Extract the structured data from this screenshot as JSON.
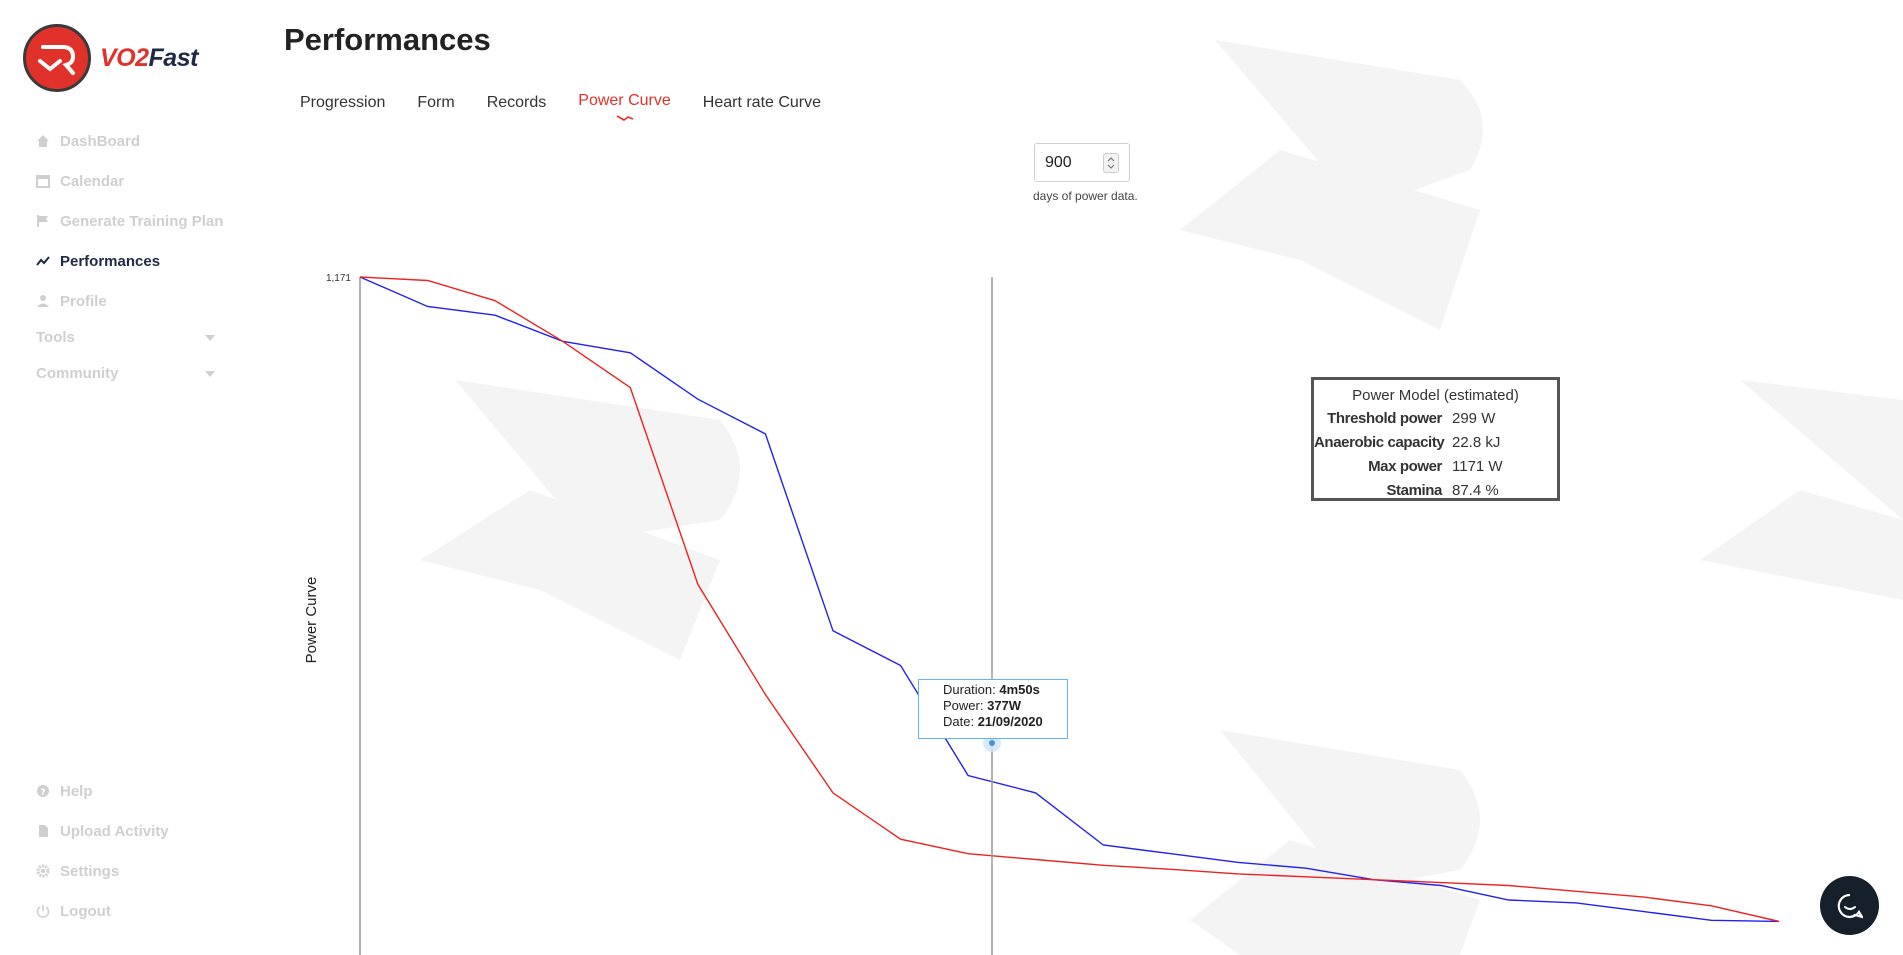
{
  "app": {
    "name_part1": "VO2",
    "name_part2": "Fast"
  },
  "sidebar": {
    "items": [
      {
        "label": "DashBoard",
        "icon": "home-icon"
      },
      {
        "label": "Calendar",
        "icon": "calendar-icon"
      },
      {
        "label": "Generate Training Plan",
        "icon": "flag-icon"
      },
      {
        "label": "Performances",
        "icon": "trend-icon",
        "active": true
      },
      {
        "label": "Profile",
        "icon": "user-icon"
      }
    ],
    "sections": [
      {
        "label": "Tools"
      },
      {
        "label": "Community"
      }
    ],
    "bottom_items": [
      {
        "label": "Help",
        "icon": "help-icon"
      },
      {
        "label": "Upload Activity",
        "icon": "file-icon"
      },
      {
        "label": "Settings",
        "icon": "gear-icon"
      },
      {
        "label": "Logout",
        "icon": "power-icon"
      }
    ]
  },
  "page": {
    "title": "Performances"
  },
  "tabs": [
    {
      "label": "Progression"
    },
    {
      "label": "Form"
    },
    {
      "label": "Records"
    },
    {
      "label": "Power Curve",
      "active": true
    },
    {
      "label": "Heart rate Curve"
    }
  ],
  "days_input": {
    "value": "900",
    "label": "days of power data."
  },
  "chart_data": {
    "type": "line",
    "ylabel": "Power Curve",
    "ymax_label": "1,171",
    "ylim": [
      0,
      1171
    ],
    "series": [
      {
        "name": "",
        "color": "#2222ee",
        "values": [
          1171,
          1120,
          1105,
          1060,
          1040,
          960,
          900,
          560,
          500,
          310,
          280,
          190,
          175,
          160,
          150,
          130,
          120,
          95,
          90,
          75,
          60,
          58
        ]
      },
      {
        "name": "",
        "color": "#ee2222",
        "values": [
          1171,
          1165,
          1130,
          1060,
          980,
          640,
          450,
          280,
          200,
          175,
          165,
          155,
          148,
          140,
          135,
          130,
          125,
          120,
          110,
          100,
          85,
          58
        ]
      }
    ],
    "highlight": {
      "duration": "4m50s",
      "power": "377W",
      "date": "21/09/2020"
    }
  },
  "power_model": {
    "title": "Power Model (estimated)",
    "rows": [
      {
        "key": "Threshold power",
        "value": "299 W"
      },
      {
        "key": "Anaerobic capacity",
        "value": "22.8 kJ"
      },
      {
        "key": "Max power",
        "value": "1171 W"
      },
      {
        "key": "Stamina",
        "value": "87.4 %"
      }
    ]
  },
  "tooltip": {
    "duration_label": "Duration:",
    "duration_value": "4m50s",
    "power_label": "Power:",
    "power_value": "377W",
    "date_label": "Date:",
    "date_value": "21/09/2020"
  },
  "colors": {
    "accent": "#e0312b",
    "navy": "#1f2a44",
    "line_actual": "#2222ee",
    "line_model": "#ee2222"
  }
}
